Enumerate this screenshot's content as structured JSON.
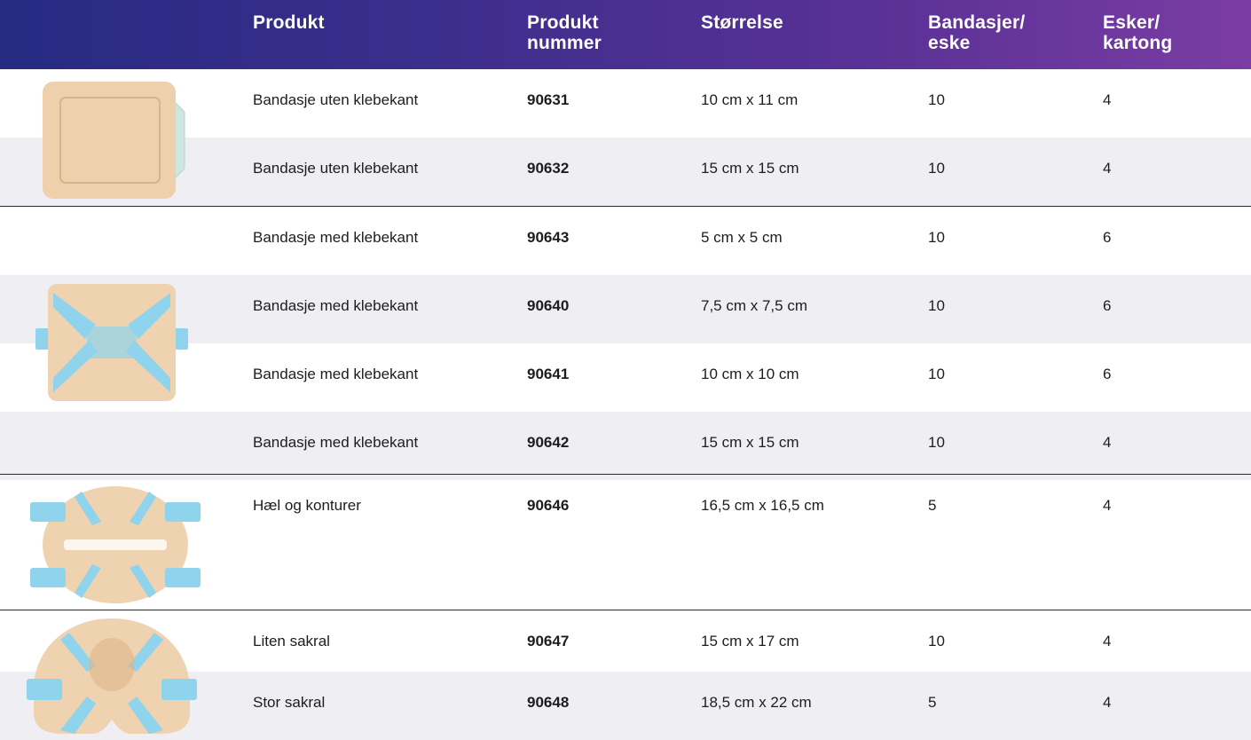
{
  "header": {
    "produkt": "Produkt",
    "produkt_nummer_1": "Produkt",
    "produkt_nummer_2": "nummer",
    "storrelse": "Størrelse",
    "bandasjer_1": "Bandasjer/",
    "bandasjer_2": "eske",
    "esker_1": "Esker/",
    "esker_2": "kartong"
  },
  "rows": [
    {
      "produkt": "Bandasje uten klebekant",
      "nummer": "90631",
      "storrelse": "10 cm x 11 cm",
      "bandasjer": "10",
      "esker": "4"
    },
    {
      "produkt": "Bandasje uten klebekant",
      "nummer": "90632",
      "storrelse": "15 cm x 15 cm",
      "bandasjer": "10",
      "esker": "4"
    },
    {
      "produkt": "Bandasje med klebekant",
      "nummer": "90643",
      "storrelse": "5 cm x 5 cm",
      "bandasjer": "10",
      "esker": "6"
    },
    {
      "produkt": "Bandasje med klebekant",
      "nummer": "90640",
      "storrelse": "7,5 cm x 7,5 cm",
      "bandasjer": "10",
      "esker": "6"
    },
    {
      "produkt": "Bandasje med klebekant",
      "nummer": "90641",
      "storrelse": "10 cm x 10 cm",
      "bandasjer": "10",
      "esker": "6"
    },
    {
      "produkt": "Bandasje med klebekant",
      "nummer": "90642",
      "storrelse": "15 cm x 15 cm",
      "bandasjer": "10",
      "esker": "4"
    },
    {
      "produkt": "Hæl og konturer",
      "nummer": "90646",
      "storrelse": "16,5 cm x 16,5 cm",
      "bandasjer": "5",
      "esker": "4"
    },
    {
      "produkt": "Liten sakral",
      "nummer": "90647",
      "storrelse": "15 cm x 17 cm",
      "bandasjer": "10",
      "esker": "4"
    },
    {
      "produkt": "Stor sakral",
      "nummer": "90648",
      "storrelse": "18,5 cm x 22 cm",
      "bandasjer": "5",
      "esker": "4"
    }
  ],
  "colors": {
    "header_start": "#262b82",
    "header_end": "#7a3da3",
    "row_shade": "#eeeef3",
    "foam": "#efd2b0",
    "adhesive": "#8fd3ec"
  }
}
